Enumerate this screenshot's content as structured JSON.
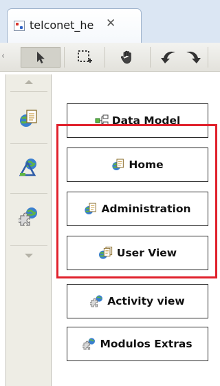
{
  "tab": {
    "title": "telconet_he",
    "close_glyph": "✕",
    "icon": "diagram-file-icon"
  },
  "toolbar": {
    "tools": [
      {
        "name": "select-tool",
        "icon": "arrow-pointer-icon"
      },
      {
        "name": "marquee-tool",
        "icon": "marquee-icon"
      },
      {
        "name": "pan-tool",
        "icon": "hand-icon"
      },
      {
        "name": "back-tool",
        "icon": "curved-arrow-left-icon"
      },
      {
        "name": "forward-tool",
        "icon": "curved-arrow-right-icon"
      }
    ]
  },
  "palette": {
    "items": [
      {
        "name": "globe-page-icon"
      },
      {
        "name": "globe-triangle-icon"
      },
      {
        "name": "globe-puzzle-icon"
      }
    ]
  },
  "canvas": {
    "buttons": [
      {
        "label": "Data Model",
        "icon": "data-model-icon"
      },
      {
        "label": "Home",
        "icon": "globe-page-icon"
      },
      {
        "label": "Administration",
        "icon": "globe-page-icon"
      },
      {
        "label": "User View",
        "icon": "globe-page-multi-icon"
      },
      {
        "label": "Activity view",
        "icon": "puzzle-icon"
      },
      {
        "label": "Modulos Extras",
        "icon": "puzzle-icon"
      }
    ]
  },
  "colors": {
    "highlight": "#e0212c",
    "tabstrip": "#dbe6f3",
    "palette": "#eeede5"
  }
}
